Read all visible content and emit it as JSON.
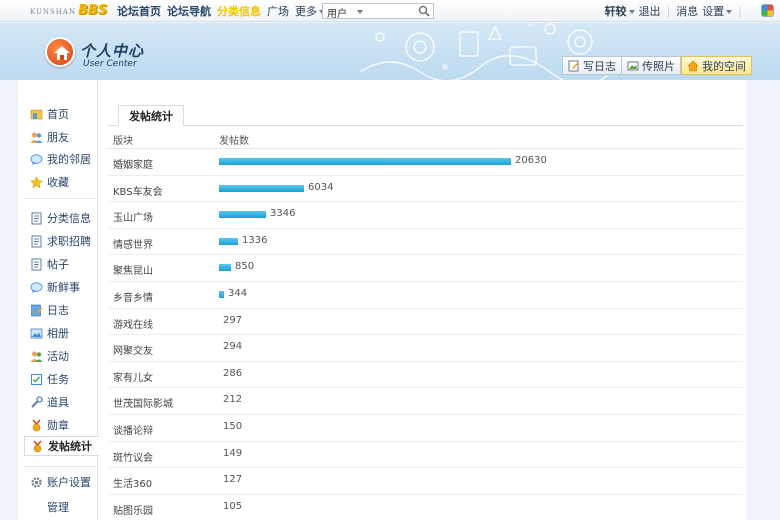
{
  "topbar": {
    "logo_small": "KUNSHAN",
    "logo_big": "BBS",
    "nav": [
      {
        "label": "论坛首页",
        "style": "bold"
      },
      {
        "label": "论坛导航",
        "style": "bold"
      },
      {
        "label": "分类信息",
        "style": "hot"
      },
      {
        "label": "广场",
        "style": "normal"
      },
      {
        "label": "更多",
        "style": "normal"
      }
    ],
    "search_select": "用户",
    "search_placeholder": "",
    "username": "轩较",
    "logout": "退出",
    "messages": "消息",
    "settings": "设置"
  },
  "header": {
    "title": "个人中心",
    "subtitle": "User Center",
    "buttons": [
      {
        "label": "写日志",
        "icon": "edit-icon"
      },
      {
        "label": "传照片",
        "icon": "photo-icon"
      },
      {
        "label": "我的空间",
        "icon": "home-icon",
        "active": true
      }
    ]
  },
  "sidebar": {
    "items": [
      {
        "label": "首页",
        "icon": "home-icon"
      },
      {
        "label": "朋友",
        "icon": "friends-icon"
      },
      {
        "label": "我的邻居",
        "icon": "chat-icon"
      },
      {
        "label": "收藏",
        "icon": "star-icon"
      },
      {
        "label": "分类信息",
        "icon": "document-icon"
      },
      {
        "label": "求职招聘",
        "icon": "document-icon"
      },
      {
        "label": "帖子",
        "icon": "document-icon"
      },
      {
        "label": "新鲜事",
        "icon": "chat-icon"
      },
      {
        "label": "日志",
        "icon": "notebook-icon"
      },
      {
        "label": "相册",
        "icon": "album-icon"
      },
      {
        "label": "活动",
        "icon": "people-icon"
      },
      {
        "label": "任务",
        "icon": "task-icon"
      },
      {
        "label": "道具",
        "icon": "tools-icon"
      },
      {
        "label": "勋章",
        "icon": "medal-icon"
      },
      {
        "label": "发帖统计",
        "icon": "medal-icon",
        "active": true
      },
      {
        "label": "账户设置",
        "icon": "gear-icon"
      },
      {
        "label": "管理",
        "icon": ""
      }
    ]
  },
  "tab": {
    "label": "发帖统计"
  },
  "table": {
    "col_board": "版块",
    "col_count": "发帖数",
    "max": 20630,
    "rows": [
      {
        "board": "婚姻家庭",
        "count": 20630
      },
      {
        "board": "KBS车友会",
        "count": 6034
      },
      {
        "board": "玉山广场",
        "count": 3346
      },
      {
        "board": "情感世界",
        "count": 1336
      },
      {
        "board": "聚焦昆山",
        "count": 850
      },
      {
        "board": "乡音乡情",
        "count": 344
      },
      {
        "board": "游戏在线",
        "count": 297
      },
      {
        "board": "网聚交友",
        "count": 294
      },
      {
        "board": "家有儿女",
        "count": 286
      },
      {
        "board": "世茂国际影城",
        "count": 212
      },
      {
        "board": "谈播论辩",
        "count": 150
      },
      {
        "board": "斑竹议会",
        "count": 149
      },
      {
        "board": "生活360",
        "count": 127
      },
      {
        "board": "贴图乐园",
        "count": 105
      }
    ]
  },
  "colors": {
    "bar": "#1a9fd6",
    "hot_nav": "#f3c400",
    "link": "#2a466a"
  }
}
